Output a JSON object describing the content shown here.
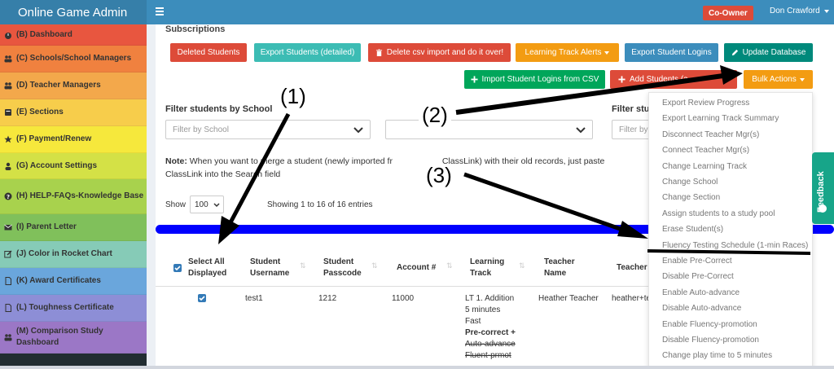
{
  "app": {
    "title": "Online Game Admin"
  },
  "topbar": {
    "role_badge": "Co-Owner",
    "user_name": "Don Crawford"
  },
  "sidebar": {
    "items": [
      {
        "label": "(B) Dashboard",
        "icon": "dashboard-icon",
        "color": "#e8563f"
      },
      {
        "label": "(C) Schools/School Managers",
        "icon": "users-icon",
        "color": "#f0813f"
      },
      {
        "label": "(D) Teacher Managers",
        "icon": "users-icon",
        "color": "#f3a84b"
      },
      {
        "label": "(E) Sections",
        "icon": "book-icon",
        "color": "#f7cd4b"
      },
      {
        "label": "(F) Payment/Renew",
        "icon": "star-icon",
        "color": "#f6e83c"
      },
      {
        "label": "(G) Account Settings",
        "icon": "user-icon",
        "color": "#d4e146"
      },
      {
        "label": "(H) HELP-FAQs-Knowledge Base",
        "icon": "help-icon",
        "color": "#a8d24d"
      },
      {
        "label": "(I) Parent Letter",
        "icon": "envelope-icon",
        "color": "#80c05b"
      },
      {
        "label": "(J) Color in Rocket Chart",
        "icon": "edit-icon",
        "color": "#86cbb7"
      },
      {
        "label": "(K) Award Certificates",
        "icon": "file-icon",
        "color": "#6aa6dc"
      },
      {
        "label": "(L) Toughness Certificate",
        "icon": "file-icon",
        "color": "#8d8ed6"
      },
      {
        "label": "(M) Comparison Study Dashboard",
        "icon": "users-icon",
        "color": "#9b77c6"
      }
    ]
  },
  "content": {
    "section_title": "Subscriptions",
    "buttons": {
      "deleted_students": "Deleted Students",
      "export_detailed": "Export Students (detailed)",
      "delete_csv": "Delete csv import and do it over!",
      "track_alerts": "Learning Track Alerts",
      "export_logins": "Export Student Logins",
      "update_db": "Update Database",
      "import_logins": "Import Student Logins from CSV",
      "add_students": "Add Students (a",
      "bulk_actions": "Bulk Actions"
    },
    "filters": {
      "school_label": "Filter students by School",
      "school_placeholder": "Filter by School",
      "other_label": "Filter stu",
      "other_placeholder": "Filter by"
    },
    "note": {
      "bold": "Note:",
      "line1": "When you want to merge a student (newly imported fr",
      "line1b": "ClassLink) with their old records, just paste",
      "line2": "ClassLink into the Search field"
    },
    "show_label": "Show",
    "show_value": "100",
    "entries_info": "Showing 1 to 16 of 16 entries",
    "table": {
      "headers": {
        "select_all": [
          "Select All",
          "Displayed"
        ],
        "username": [
          "Student",
          "Username"
        ],
        "passcode": [
          "Student",
          "Passcode"
        ],
        "account": [
          "Account #"
        ],
        "track": [
          "Learning",
          "Track"
        ],
        "teacher_name": [
          "Teacher",
          "Name"
        ],
        "teacher": [
          "Teacher"
        ]
      },
      "row": {
        "username": "test1",
        "passcode": "1212",
        "account": "11000",
        "track": [
          "LT 1. Addition",
          "5 minutes",
          "Fast"
        ],
        "track_bold": "Pre-correct +",
        "track_strike": [
          "Auto-advance",
          "Fluent-prmot"
        ],
        "teacher_name": "Heather Teacher",
        "teacher": "heather+te"
      }
    }
  },
  "bulk_menu": {
    "items": [
      "Export Review Progress",
      "Export Learning Track Summary",
      "Disconnect Teacher Mgr(s)",
      "Connect Teacher Mgr(s)",
      "Change Learning Track",
      "Change School",
      "Change Section",
      "Assign students to a study pool",
      "Erase Student(s)",
      "Fluency Testing Schedule (1-min Races)",
      "Enable Pre-Correct",
      "Disable Pre-Correct",
      "Enable Auto-advance",
      "Disable Auto-advance",
      "Enable Fluency-promotion",
      "Disable Fluency-promotion",
      "Change play time to 5 minutes"
    ]
  },
  "feedback": {
    "label": "Feedback"
  },
  "annotations": {
    "label1": "(1)",
    "label2": "(2)",
    "label3": "(3)"
  },
  "colors": {
    "topbar": "#3c8dbc",
    "brand": "#367fa9",
    "danger": "#dd4b39",
    "teal": "#3cbcb4",
    "warning": "#f39c12",
    "primary": "#3c8dbc",
    "green": "#00a65a",
    "dark_teal": "#00897b"
  }
}
